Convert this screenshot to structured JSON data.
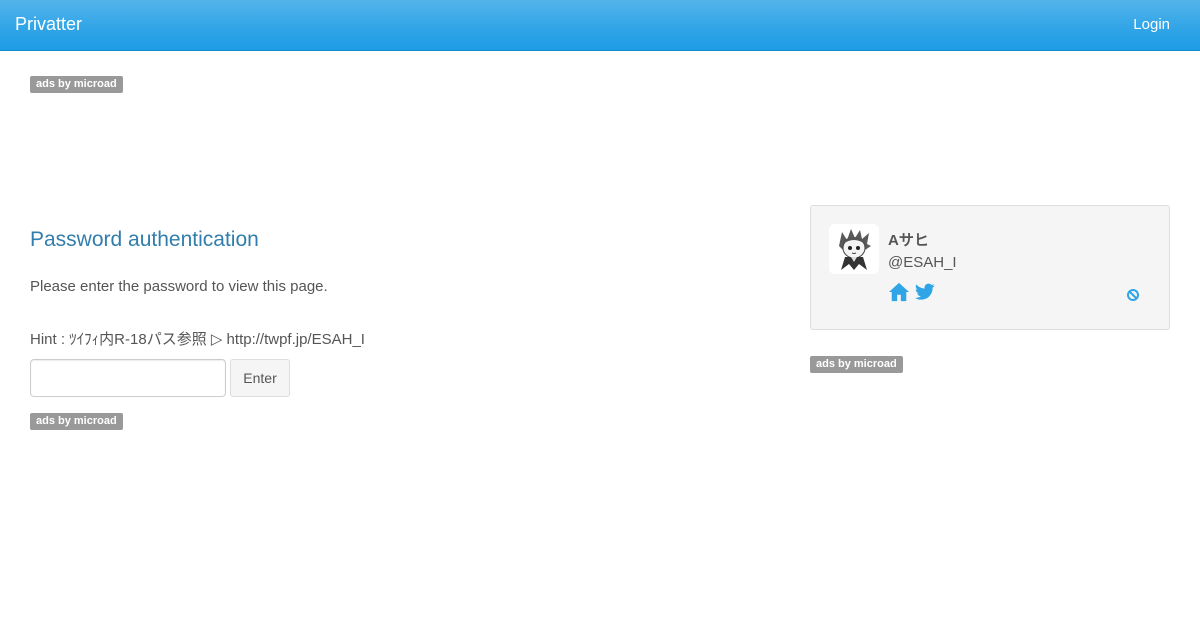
{
  "navbar": {
    "brand": "Privatter",
    "login_label": "Login"
  },
  "ads": {
    "label": "ads by microad"
  },
  "main": {
    "title": "Password authentication",
    "description": "Please enter the password to view this page.",
    "hint": "Hint : ﾂｲﾌｨ内R-18パス参照 ▷ http://twpf.jp/ESAH_I",
    "password_value": "",
    "enter_label": "Enter"
  },
  "profile": {
    "name": "Aサヒ",
    "handle": "@ESAH_I",
    "icons": [
      "home-icon",
      "twitter-icon",
      "block-icon"
    ],
    "icon_color": "#2fa4e7"
  },
  "colors": {
    "navbar": "#2fa4e7",
    "title": "#317eac",
    "badge": "#999999"
  }
}
